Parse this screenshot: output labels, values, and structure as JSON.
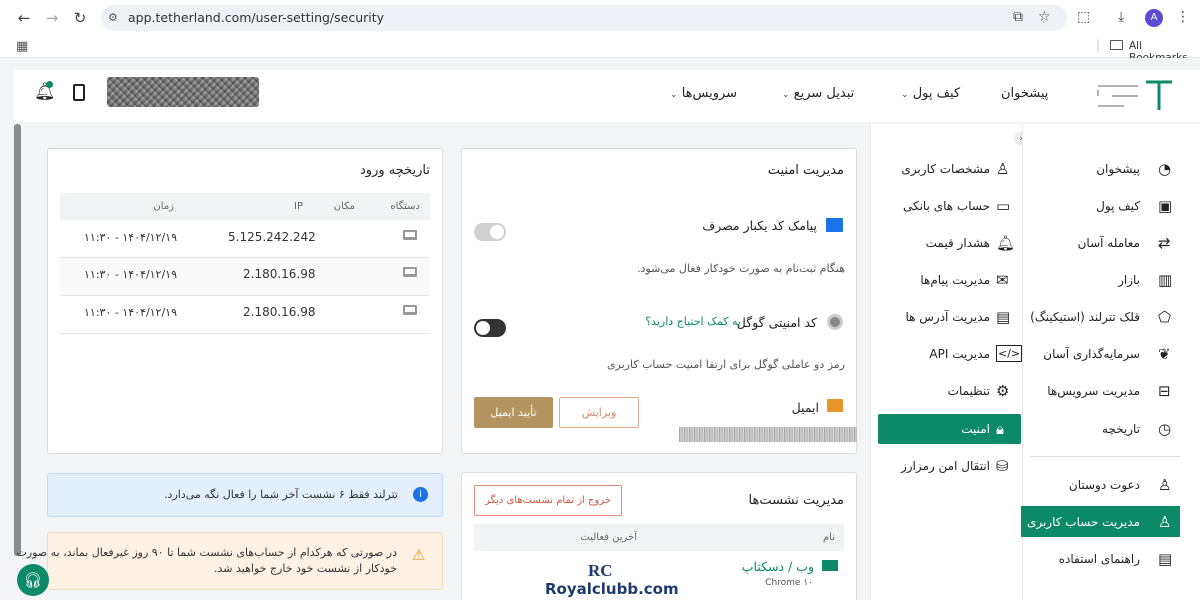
{
  "browser": {
    "url": "app.tetherland.com/user-setting/security",
    "bookmarks_label": "All Bookmarks",
    "avatar_letter": "A"
  },
  "header": {
    "logo_text": "تتر لند",
    "nav": [
      {
        "label": "پیشخوان"
      },
      {
        "label": "کیف پول"
      },
      {
        "label": "تبدیل سریع"
      },
      {
        "label": "سرویس‌ها"
      }
    ]
  },
  "sidebar_main": {
    "items": [
      {
        "label": "پیشخوان",
        "icon": "chart-pie-icon"
      },
      {
        "label": "کیف پول",
        "icon": "wallet-icon"
      },
      {
        "label": "معامله آسان",
        "icon": "exchange-icon"
      },
      {
        "label": "بازار",
        "icon": "bar-chart-icon"
      },
      {
        "label": "قلک تترلند (استیکینگ)",
        "icon": "piggy-icon"
      },
      {
        "label": "سرمایه‌گذاری آسان",
        "icon": "plant-hand-icon"
      },
      {
        "label": "مدیریت سرویس‌ها",
        "icon": "briefcase-icon"
      },
      {
        "label": "تاریخچه",
        "icon": "history-icon"
      },
      {
        "label": "دعوت دوستان",
        "icon": "user-plus-icon"
      },
      {
        "label": "مدیریت حساب کاربری",
        "icon": "user-settings-icon",
        "active": true
      },
      {
        "label": "راهنمای استفاده",
        "icon": "book-icon"
      }
    ]
  },
  "sidebar_settings": {
    "items": [
      {
        "label": "مشخصات کاربری",
        "icon": "user-icon"
      },
      {
        "label": "حساب های بانکی",
        "icon": "card-icon"
      },
      {
        "label": "هشدار قیمت",
        "icon": "bell-plus-icon"
      },
      {
        "label": "مدیریت پیام‌ها",
        "icon": "mail-icon"
      },
      {
        "label": "مدیریت آدرس ها",
        "icon": "clipboard-icon"
      },
      {
        "label": "مدیریت API",
        "icon": "code-icon"
      },
      {
        "label": "تنظیمات",
        "icon": "gear-icon"
      },
      {
        "label": "امنیت",
        "icon": "lock-icon",
        "active": true
      },
      {
        "label": "انتقال امن رمزارز",
        "icon": "coins-icon"
      }
    ]
  },
  "security": {
    "title": "مدیریت امنیت",
    "sms_title": "پیامک کد یکبار مصرف",
    "sms_desc": "هنگام ثبت‌نام به صورت خودکار فعال می‌شود.",
    "sms_enabled": true,
    "google_title": "کد امنیتی گوگل",
    "google_help": "به کمک احتیاج دارید؟",
    "google_desc": "رمز دو عاملی گوگل برای ارتقا امنیت حساب کاربری",
    "google_enabled": false,
    "email_title": "ایمیل",
    "edit_button": "ویرایش",
    "verify_button": "تأیید ایمیل"
  },
  "login_history": {
    "title": "تاریخچه ورود",
    "columns": [
      "دستگاه",
      "مکان",
      "IP",
      "زمان"
    ],
    "rows": [
      {
        "ip": "5.125.242.242",
        "time": "۱۴۰۴/۱۲/۱۹ - ۱۱:۳۰"
      },
      {
        "ip": "2.180.16.98",
        "time": "۱۴۰۴/۱۲/۱۹ - ۱۱:۳۰"
      },
      {
        "ip": "2.180.16.98",
        "time": "۱۴۰۴/۱۲/۱۹ - ۱۱:۳۰"
      }
    ]
  },
  "info_text": "تترلند فقط ۶ نشست آخر شما را فعال نگه می‌دارد.",
  "warning_text_1": "در صورتی که هرکدام از حساب‌های نشست شما تا ۹۰ روز غیرفعال بماند، به صورت",
  "warning_text_2": "خودکار از نشست خود خارج خواهید شد.",
  "sessions": {
    "title": "مدیریت نشست‌ها",
    "logout_all": "خروج از تمام نشست‌های دیگر",
    "col_name": "نام",
    "col_last": "آخرین فعالیت",
    "session_name": "وب / دسکتاپ",
    "session_browser": "Chrome ۱۰"
  },
  "watermark": "Royalclubb.com",
  "colors": {
    "accent": "#0c8a67",
    "sms_toggle_on": "#d0d0d0",
    "verify_button": "#b5955f"
  }
}
